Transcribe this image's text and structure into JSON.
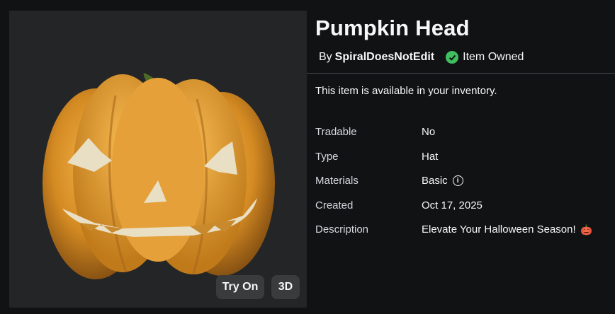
{
  "item": {
    "title": "Pumpkin Head",
    "by_prefix": "By",
    "creator": "SpiralDoesNotEdit",
    "owned_label": "Item Owned",
    "availability_text": "This item is available in your inventory."
  },
  "preview": {
    "try_on_label": "Try On",
    "three_d_label": "3D"
  },
  "details": [
    {
      "label": "Tradable",
      "value": "No"
    },
    {
      "label": "Type",
      "value": "Hat"
    },
    {
      "label": "Materials",
      "value": "Basic",
      "icon": "info-icon"
    },
    {
      "label": "Created",
      "value": "Oct 17, 2025"
    },
    {
      "label": "Description",
      "value": "Elevate Your Halloween Season!",
      "icon": "pumpkin-emoji-icon"
    }
  ],
  "colors": {
    "background": "#111214",
    "panel": "#232527",
    "button": "#393b3d",
    "owned_check": "#3fbf5f",
    "pumpkin": "#d98a1e"
  }
}
